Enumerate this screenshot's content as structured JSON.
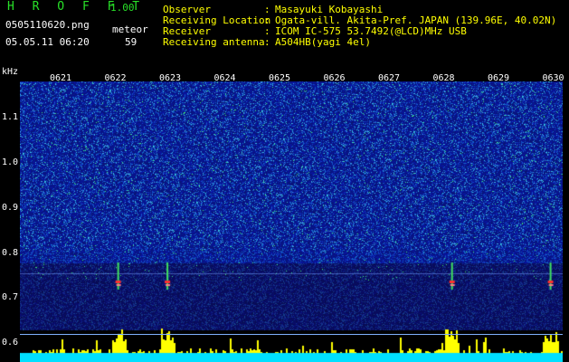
{
  "header": {
    "app_title": "H R O F F T",
    "app_version": "1.00",
    "file_name": "0505110620.png",
    "date_time": "05.05.11 06:20",
    "meteor_label": "meteor",
    "meteor_count": "59"
  },
  "info": [
    {
      "label": "Observer",
      "value": "Masayuki Kobayashi"
    },
    {
      "label": "Receiving Location",
      "value": "Ogata-vill. Akita-Pref. JAPAN (139.96E, 40.02N)"
    },
    {
      "label": "Receiver",
      "value": "ICOM IC-575 53.7492(@LCD)MHz USB"
    },
    {
      "label": "Receiving antenna",
      "value": "A504HB(yagi 4el)"
    }
  ],
  "axis": {
    "y_unit": "kHz",
    "y_ticks": [
      "1.1",
      "1.0",
      "0.9",
      "0.8",
      "0.7",
      "0.6"
    ],
    "time_ticks": [
      "0621",
      "0622",
      "0623",
      "0624",
      "0625",
      "0626",
      "0627",
      "0628",
      "0629",
      "0630"
    ]
  },
  "colors": {
    "background": "#000000",
    "spectrogram_base": "#0a1a8a",
    "accent_green": "#28e028",
    "meteor_red": "#ff3030",
    "signal_yellow": "#ffff00",
    "baseline_cyan": "#00e0ff"
  },
  "meteor_events": [
    {
      "minute": 1.3
    },
    {
      "minute": 2.2
    },
    {
      "minute": 7.4
    },
    {
      "minute": 9.2
    }
  ]
}
